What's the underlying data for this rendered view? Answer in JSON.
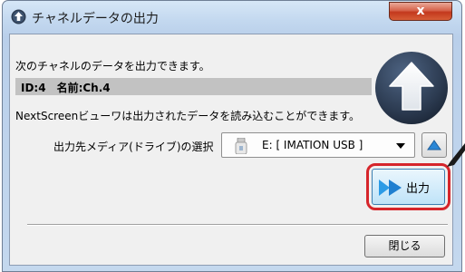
{
  "window": {
    "title": "チャネルデータの出力",
    "close_glyph": "x"
  },
  "content": {
    "message": "次のチャネルのデータを出力できます。",
    "channel_info": "ID:4　名前:Ch.4",
    "note": "NextScreenビューワは出力されたデータを読み込むことができます。"
  },
  "media": {
    "label": "出力先メディア(ドライブ)の選択",
    "selected": "E: [ IMATION USB ]",
    "icon": "usb-drive-icon"
  },
  "buttons": {
    "output_label": "出力",
    "close_label": "閉じる"
  },
  "colors": {
    "highlight": "#d6252b",
    "info_bar": "#c2c2c2",
    "upload_icon": "#2f3f55"
  }
}
